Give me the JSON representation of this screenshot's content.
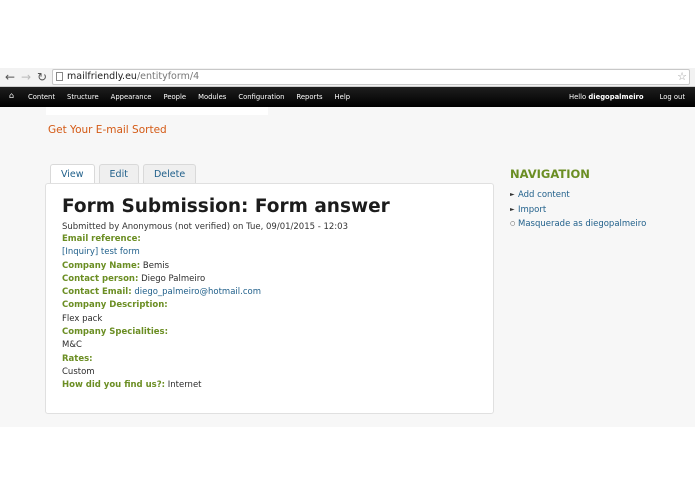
{
  "browser": {
    "url_domain": "mailfriendly.eu",
    "url_path": "/entityform/4",
    "back_icon": "back-arrow-icon",
    "forward_icon": "forward-arrow-icon",
    "reload_icon": "reload-icon",
    "star_icon": "star-icon"
  },
  "admin_bar": {
    "home_icon": "home-icon",
    "menu": [
      "Content",
      "Structure",
      "Appearance",
      "People",
      "Modules",
      "Configuration",
      "Reports",
      "Help"
    ],
    "hello": "Hello",
    "username": "diegopalmeiro",
    "logout": "Log out"
  },
  "site": {
    "name": "Get Your E-mail Sorted"
  },
  "tabs": [
    "View",
    "Edit",
    "Delete"
  ],
  "content": {
    "title": "Form Submission: Form answer",
    "submitted": "Submitted by Anonymous (not verified) on Tue, 09/01/2015 - 12:03",
    "email_reference_label": "Email reference:",
    "email_reference_value": "[Inquiry] test form",
    "company_name_label": "Company Name:",
    "company_name_value": "Bemis",
    "contact_person_label": "Contact person:",
    "contact_person_value": "Diego Palmeiro",
    "contact_email_label": "Contact Email:",
    "contact_email_value": "diego_palmeiro@hotmail.com",
    "company_description_label": "Company Description:",
    "company_description_value": "Flex pack",
    "company_specialities_label": "Company Specialities:",
    "company_specialities_value": "M&C",
    "rates_label": "Rates:",
    "rates_value": "Custom",
    "found_label": "How did you find us?:",
    "found_value": "Internet"
  },
  "sidebar": {
    "title": "NAVIGATION",
    "items": [
      "Add content",
      "Import",
      "Masquerade as diegopalmeiro"
    ]
  },
  "colors": {
    "accent_orange": "#d45a15",
    "label_green": "#6b8e23",
    "link_blue": "#1f5f8a",
    "admin_bar": "#000000"
  }
}
